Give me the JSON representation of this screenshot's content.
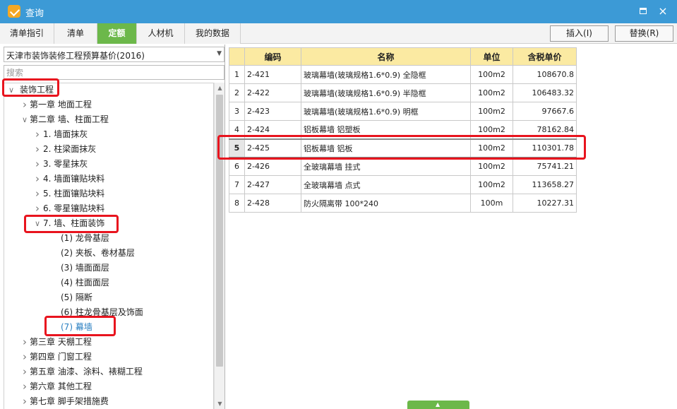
{
  "window": {
    "title": "查询",
    "icons": {
      "app": "app-logo-icon",
      "maximize": "maximize-icon",
      "close": "close-icon"
    },
    "close_glyph": "×"
  },
  "tabs": [
    {
      "label": "清单指引",
      "active": false
    },
    {
      "label": "清单",
      "active": false
    },
    {
      "label": "定额",
      "active": true
    },
    {
      "label": "人材机",
      "active": false
    },
    {
      "label": "我的数据",
      "active": false
    }
  ],
  "actions": {
    "insert_label": "插入(I)",
    "replace_label": "替换(R)"
  },
  "library": {
    "selected": "天津市装饰装修工程预算基价(2016)",
    "search_placeholder": "搜索"
  },
  "tree": [
    {
      "label": "装饰工程",
      "level": 0,
      "expanded": true,
      "has_children": true
    },
    {
      "label": "第一章  地面工程",
      "level": 1,
      "expanded": false,
      "has_children": true
    },
    {
      "label": "第二章  墙、柱面工程",
      "level": 1,
      "expanded": true,
      "has_children": true
    },
    {
      "label": "1.  墙面抹灰",
      "level": 2,
      "expanded": false,
      "has_children": true
    },
    {
      "label": "2.  柱梁面抹灰",
      "level": 2,
      "expanded": false,
      "has_children": true
    },
    {
      "label": "3.  零星抹灰",
      "level": 2,
      "expanded": false,
      "has_children": true
    },
    {
      "label": "4.  墙面镶贴块料",
      "level": 2,
      "expanded": false,
      "has_children": true
    },
    {
      "label": "5.  柱面镶贴块料",
      "level": 2,
      "expanded": false,
      "has_children": true
    },
    {
      "label": "6.  零星镶贴块料",
      "level": 2,
      "expanded": false,
      "has_children": true
    },
    {
      "label": "7.  墙、柱面装饰",
      "level": 2,
      "expanded": true,
      "has_children": true
    },
    {
      "label": "(1) 龙骨基层",
      "level": 3,
      "expanded": false,
      "has_children": false
    },
    {
      "label": "(2) 夹板、卷材基层",
      "level": 3,
      "expanded": false,
      "has_children": false
    },
    {
      "label": "(3) 墙面面层",
      "level": 3,
      "expanded": false,
      "has_children": false
    },
    {
      "label": "(4) 柱面面层",
      "level": 3,
      "expanded": false,
      "has_children": false
    },
    {
      "label": "(5) 隔断",
      "level": 3,
      "expanded": false,
      "has_children": false
    },
    {
      "label": "(6) 柱龙骨基层及饰面",
      "level": 3,
      "expanded": false,
      "has_children": false
    },
    {
      "label": "(7) 幕墙",
      "level": 3,
      "expanded": false,
      "has_children": false,
      "selected": true
    },
    {
      "label": "第三章  天棚工程",
      "level": 1,
      "expanded": false,
      "has_children": true
    },
    {
      "label": "第四章  门窗工程",
      "level": 1,
      "expanded": false,
      "has_children": true
    },
    {
      "label": "第五章  油漆、涂料、裱糊工程",
      "level": 1,
      "expanded": false,
      "has_children": true
    },
    {
      "label": "第六章  其他工程",
      "level": 1,
      "expanded": false,
      "has_children": true
    },
    {
      "label": "第七章  脚手架措施费",
      "level": 1,
      "expanded": false,
      "has_children": true
    }
  ],
  "table": {
    "columns": [
      "",
      "编码",
      "名称",
      "单位",
      "含税单价"
    ],
    "rows": [
      {
        "no": "1",
        "code": "2-421",
        "name": "玻璃幕墙(玻璃规格1.6*0.9) 全隐框",
        "unit": "100m2",
        "price": "108670.8"
      },
      {
        "no": "2",
        "code": "2-422",
        "name": "玻璃幕墙(玻璃规格1.6*0.9) 半隐框",
        "unit": "100m2",
        "price": "106483.32"
      },
      {
        "no": "3",
        "code": "2-423",
        "name": "玻璃幕墙(玻璃规格1.6*0.9) 明框",
        "unit": "100m2",
        "price": "97667.6"
      },
      {
        "no": "4",
        "code": "2-424",
        "name": "铝板幕墙 铝塑板",
        "unit": "100m2",
        "price": "78162.84"
      },
      {
        "no": "5",
        "code": "2-425",
        "name": "铝板幕墙 铝板",
        "unit": "100m2",
        "price": "110301.78",
        "selected": true
      },
      {
        "no": "6",
        "code": "2-426",
        "name": "全玻璃幕墙 挂式",
        "unit": "100m2",
        "price": "75741.21"
      },
      {
        "no": "7",
        "code": "2-427",
        "name": "全玻璃幕墙 点式",
        "unit": "100m2",
        "price": "113658.27"
      },
      {
        "no": "8",
        "code": "2-428",
        "name": "防火隔离带 100*240",
        "unit": "100m",
        "price": "10227.31"
      }
    ]
  },
  "colors": {
    "titlebar": "#3c9ad6",
    "active_tab": "#6cb84a",
    "table_header": "#fbeaa2",
    "highlight": "#e8141e",
    "selected_tree_text": "#2a7fc1"
  }
}
